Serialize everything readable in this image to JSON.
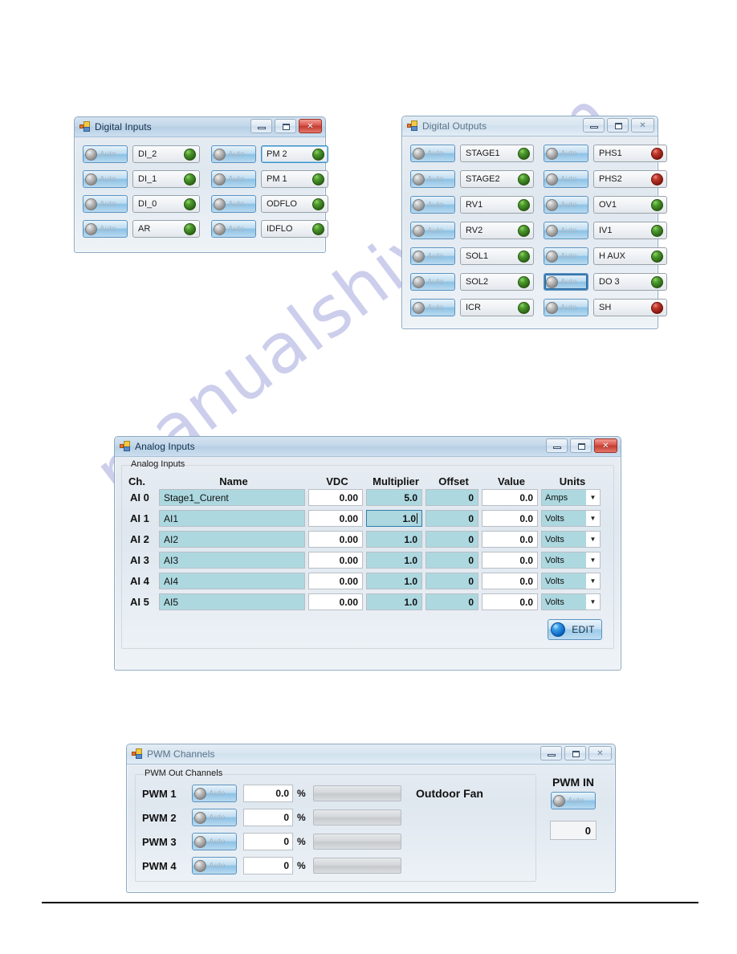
{
  "page": {
    "watermark": "manualshive.com"
  },
  "windows": {
    "digital_inputs": {
      "title": "Digital Inputs",
      "active": true,
      "caption": {
        "minimize": "minimize",
        "maximize": "maximize",
        "close": "✕"
      },
      "auto_label": "Auto",
      "columns": [
        [
          {
            "auto": "Auto",
            "name": "DI_2",
            "state": "green",
            "focused": false
          },
          {
            "auto": "Auto",
            "name": "DI_1",
            "state": "green",
            "focused": false
          },
          {
            "auto": "Auto",
            "name": "DI_0",
            "state": "green",
            "focused": false
          },
          {
            "auto": "Auto",
            "name": "AR",
            "state": "green",
            "focused": false
          }
        ],
        [
          {
            "auto": "Auto",
            "name": "PM 2",
            "state": "green",
            "focused": true
          },
          {
            "auto": "Auto",
            "name": "PM 1",
            "state": "green",
            "focused": false
          },
          {
            "auto": "Auto",
            "name": "ODFLO",
            "state": "green",
            "focused": false
          },
          {
            "auto": "Auto",
            "name": "IDFLO",
            "state": "green",
            "focused": false
          }
        ]
      ]
    },
    "digital_outputs": {
      "title": "Digital Outputs",
      "active": false,
      "caption": {
        "minimize": "minimize",
        "maximize": "maximize",
        "close": "✕"
      },
      "auto_label": "Auto",
      "columns": [
        [
          {
            "auto": "Auto",
            "name": "STAGE1",
            "state": "green",
            "auto_focused": false
          },
          {
            "auto": "Auto",
            "name": "STAGE2",
            "state": "green",
            "auto_focused": false
          },
          {
            "auto": "Auto",
            "name": "RV1",
            "state": "green",
            "auto_focused": false
          },
          {
            "auto": "Auto",
            "name": "RV2",
            "state": "green",
            "auto_focused": false
          },
          {
            "auto": "Auto",
            "name": "SOL1",
            "state": "green",
            "auto_focused": false
          },
          {
            "auto": "Auto",
            "name": "SOL2",
            "state": "green",
            "auto_focused": false
          },
          {
            "auto": "Auto",
            "name": "ICR",
            "state": "green",
            "auto_focused": false
          }
        ],
        [
          {
            "auto": "Auto",
            "name": "PHS1",
            "state": "red",
            "auto_focused": false
          },
          {
            "auto": "Auto",
            "name": "PHS2",
            "state": "red",
            "auto_focused": false
          },
          {
            "auto": "Auto",
            "name": "OV1",
            "state": "green",
            "auto_focused": false
          },
          {
            "auto": "Auto",
            "name": "IV1",
            "state": "green",
            "auto_focused": false
          },
          {
            "auto": "Auto",
            "name": "H AUX",
            "state": "green",
            "auto_focused": false
          },
          {
            "auto": "Auto",
            "name": "DO 3",
            "state": "green",
            "auto_focused": true
          },
          {
            "auto": "Auto",
            "name": "SH",
            "state": "red",
            "auto_focused": false
          }
        ]
      ]
    },
    "analog_inputs": {
      "title": "Analog Inputs",
      "active": true,
      "caption": {
        "minimize": "minimize",
        "maximize": "maximize",
        "close": "✕"
      },
      "group_label": "Analog Inputs",
      "headers": [
        "Ch.",
        "Name",
        "VDC",
        "Multiplier",
        "Offset",
        "Value",
        "Units"
      ],
      "rows": [
        {
          "ch": "AI 0",
          "name": "Stage1_Curent",
          "vdc": "0.00",
          "multiplier": "5.0",
          "offset": "0",
          "value": "0.0",
          "units": "Amps",
          "mult_focused": false
        },
        {
          "ch": "AI 1",
          "name": "AI1",
          "vdc": "0.00",
          "multiplier": "1.0",
          "offset": "0",
          "value": "0.0",
          "units": "Volts",
          "mult_focused": true
        },
        {
          "ch": "AI 2",
          "name": "AI2",
          "vdc": "0.00",
          "multiplier": "1.0",
          "offset": "0",
          "value": "0.0",
          "units": "Volts",
          "mult_focused": false
        },
        {
          "ch": "AI 3",
          "name": "AI3",
          "vdc": "0.00",
          "multiplier": "1.0",
          "offset": "0",
          "value": "0.0",
          "units": "Volts",
          "mult_focused": false
        },
        {
          "ch": "AI 4",
          "name": "AI4",
          "vdc": "0.00",
          "multiplier": "1.0",
          "offset": "0",
          "value": "0.0",
          "units": "Volts",
          "mult_focused": false
        },
        {
          "ch": "AI 5",
          "name": "AI5",
          "vdc": "0.00",
          "multiplier": "1.0",
          "offset": "0",
          "value": "0.0",
          "units": "Volts",
          "mult_focused": false
        }
      ],
      "edit_button": "EDIT",
      "unit_options": [
        "Volts",
        "Amps"
      ]
    },
    "pwm_channels": {
      "title": "PWM Channels",
      "active": false,
      "caption": {
        "minimize": "minimize",
        "maximize": "maximize",
        "close": "✕"
      },
      "group_label": "PWM Out Channels",
      "auto_label": "Auto",
      "percent_symbol": "%",
      "rows": [
        {
          "label": "PWM 1",
          "auto": "Auto",
          "value": "0.0",
          "unit": "%",
          "bar_percent": 0,
          "name": "Outdoor Fan"
        },
        {
          "label": "PWM 2",
          "auto": "Auto",
          "value": "0",
          "unit": "%",
          "bar_percent": 0,
          "name": ""
        },
        {
          "label": "PWM 3",
          "auto": "Auto",
          "value": "0",
          "unit": "%",
          "bar_percent": 0,
          "name": ""
        },
        {
          "label": "PWM 4",
          "auto": "Auto",
          "value": "0",
          "unit": "%",
          "bar_percent": 0,
          "name": ""
        }
      ],
      "pwm_in": {
        "title": "PWM IN",
        "auto": "Auto",
        "value": "0"
      }
    }
  }
}
